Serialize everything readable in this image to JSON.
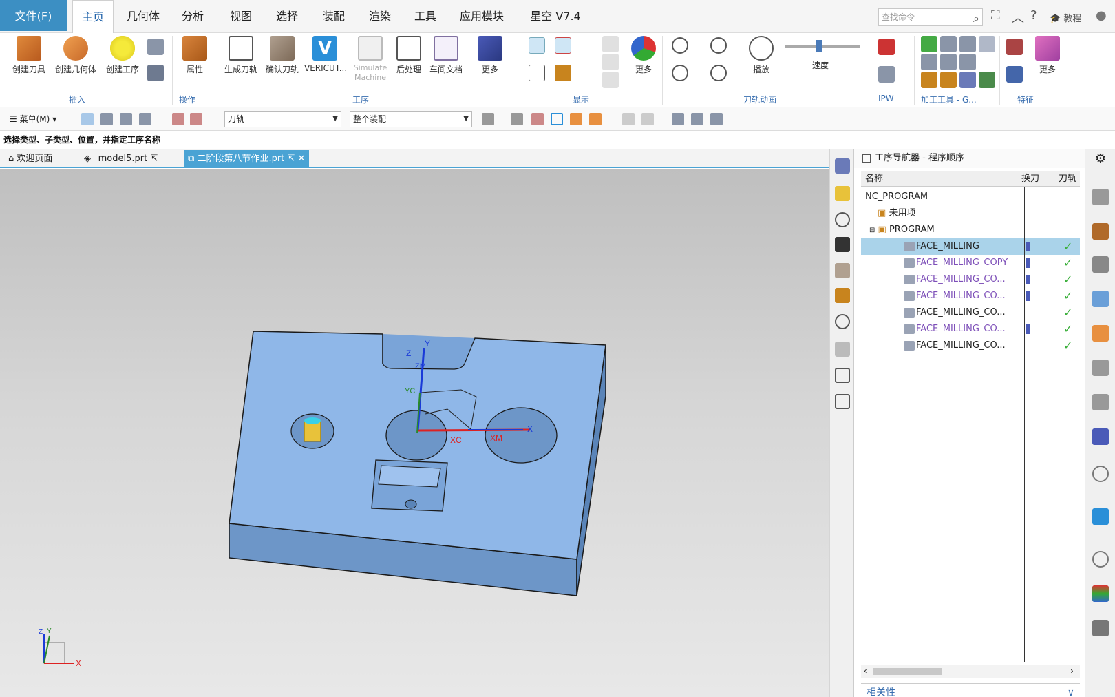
{
  "menu": {
    "file": "文件(F)",
    "tabs": [
      "主页",
      "几何体",
      "分析",
      "视图",
      "选择",
      "装配",
      "渲染",
      "工具",
      "应用模块",
      "星空 V7.4"
    ],
    "search_placeholder": "查找命令",
    "tutorial": "教程"
  },
  "ribbon": {
    "insert": {
      "create_tool": "创建刀具",
      "create_geometry": "创建几何体",
      "create_operation": "创建工序",
      "group": "插入"
    },
    "ops": {
      "properties": "属性",
      "group": "操作"
    },
    "procedure": {
      "generate": "生成刀轨",
      "verify": "确认刀轨",
      "vericut": "VERICUT...",
      "simulate": "Simulate Machine",
      "postprocess": "后处理",
      "shopdoc": "车间文档",
      "more": "更多",
      "group": "工序"
    },
    "display": {
      "more": "更多",
      "group": "显示"
    },
    "animation": {
      "play": "播放",
      "speed": "速度",
      "group": "刀轨动画"
    },
    "ipw_group": "IPW",
    "tools_group": "加工工具 - G...",
    "features": {
      "more": "更多",
      "group": "特征"
    },
    "accent": "#3a6fb0"
  },
  "toolbar": {
    "menu": "菜单(M)",
    "filter1": "刀轨",
    "filter2": "整个装配"
  },
  "status": "选择类型、子类型、位置，并指定工序名称",
  "doc_tabs": [
    {
      "label": "欢迎页面"
    },
    {
      "label": "_model5.prt"
    },
    {
      "label": "二阶段第八节作业.prt"
    }
  ],
  "viewport": {
    "labels": {
      "z": "Z",
      "y": "Y",
      "zm": "ZM",
      "yc": "YC",
      "xc": "XC",
      "xm": "XM",
      "x": "X"
    },
    "triad": {
      "z": "Z",
      "y": "Y",
      "x": "X"
    },
    "part_color": "#8fb7e8"
  },
  "navigator": {
    "title": "工序导航器 - 程序顺序",
    "col_name": "名称",
    "col_tool_change": "换刀",
    "col_path": "刀轨",
    "root": "NC_PROGRAM",
    "unused": "未用项",
    "program": "PROGRAM",
    "ops": [
      {
        "name": "FACE_MILLING",
        "selected": true,
        "tool_change": true,
        "purple": false
      },
      {
        "name": "FACE_MILLING_COPY",
        "selected": false,
        "tool_change": true,
        "purple": true
      },
      {
        "name": "FACE_MILLING_CO...",
        "selected": false,
        "tool_change": true,
        "purple": true
      },
      {
        "name": "FACE_MILLING_CO...",
        "selected": false,
        "tool_change": true,
        "purple": true
      },
      {
        "name": "FACE_MILLING_CO...",
        "selected": false,
        "tool_change": false,
        "purple": false
      },
      {
        "name": "FACE_MILLING_CO...",
        "selected": false,
        "tool_change": true,
        "purple": true
      },
      {
        "name": "FACE_MILLING_CO...",
        "selected": false,
        "tool_change": false,
        "purple": false
      }
    ],
    "related": "相关性"
  }
}
